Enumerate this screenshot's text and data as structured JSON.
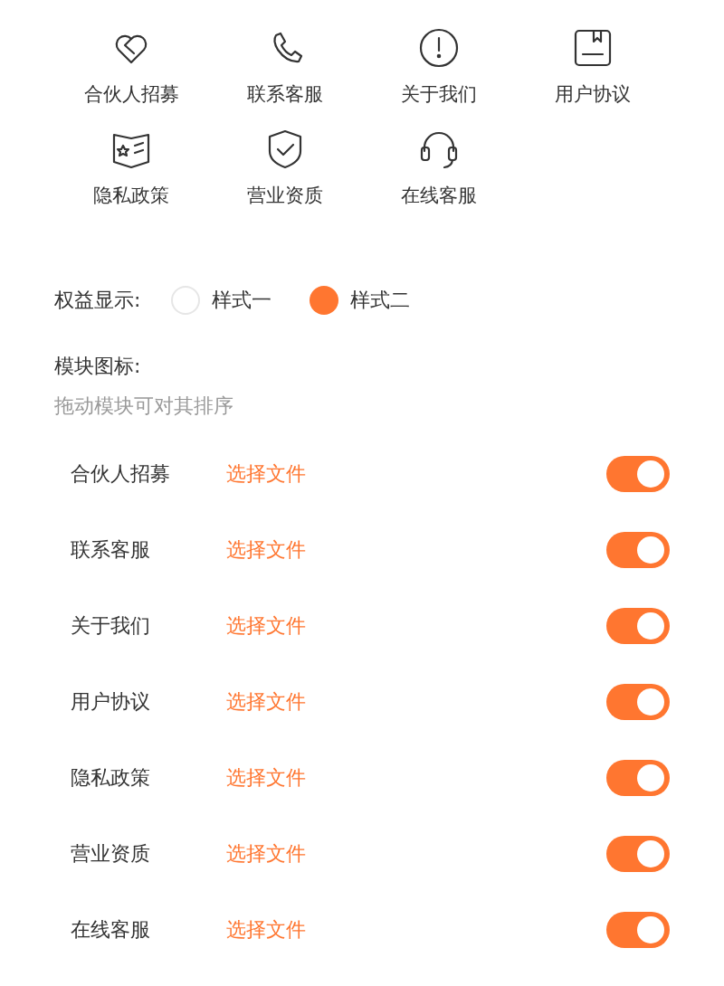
{
  "shortcuts": [
    {
      "label": "合伙人招募"
    },
    {
      "label": "联系客服"
    },
    {
      "label": "关于我们"
    },
    {
      "label": "用户协议"
    },
    {
      "label": "隐私政策"
    },
    {
      "label": "营业资质"
    },
    {
      "label": "在线客服"
    }
  ],
  "benefit_display": {
    "label": "权益显示:",
    "options": [
      {
        "label": "样式一",
        "selected": false
      },
      {
        "label": "样式二",
        "selected": true
      }
    ]
  },
  "module_icons": {
    "label": "模块图标:",
    "hint": "拖动模块可对其排序",
    "rows": [
      {
        "name": "合伙人招募",
        "action": "选择文件",
        "on": true
      },
      {
        "name": "联系客服",
        "action": "选择文件",
        "on": true
      },
      {
        "name": "关于我们",
        "action": "选择文件",
        "on": true
      },
      {
        "name": "用户协议",
        "action": "选择文件",
        "on": true
      },
      {
        "name": "隐私政策",
        "action": "选择文件",
        "on": true
      },
      {
        "name": "营业资质",
        "action": "选择文件",
        "on": true
      },
      {
        "name": "在线客服",
        "action": "选择文件",
        "on": true
      }
    ]
  }
}
